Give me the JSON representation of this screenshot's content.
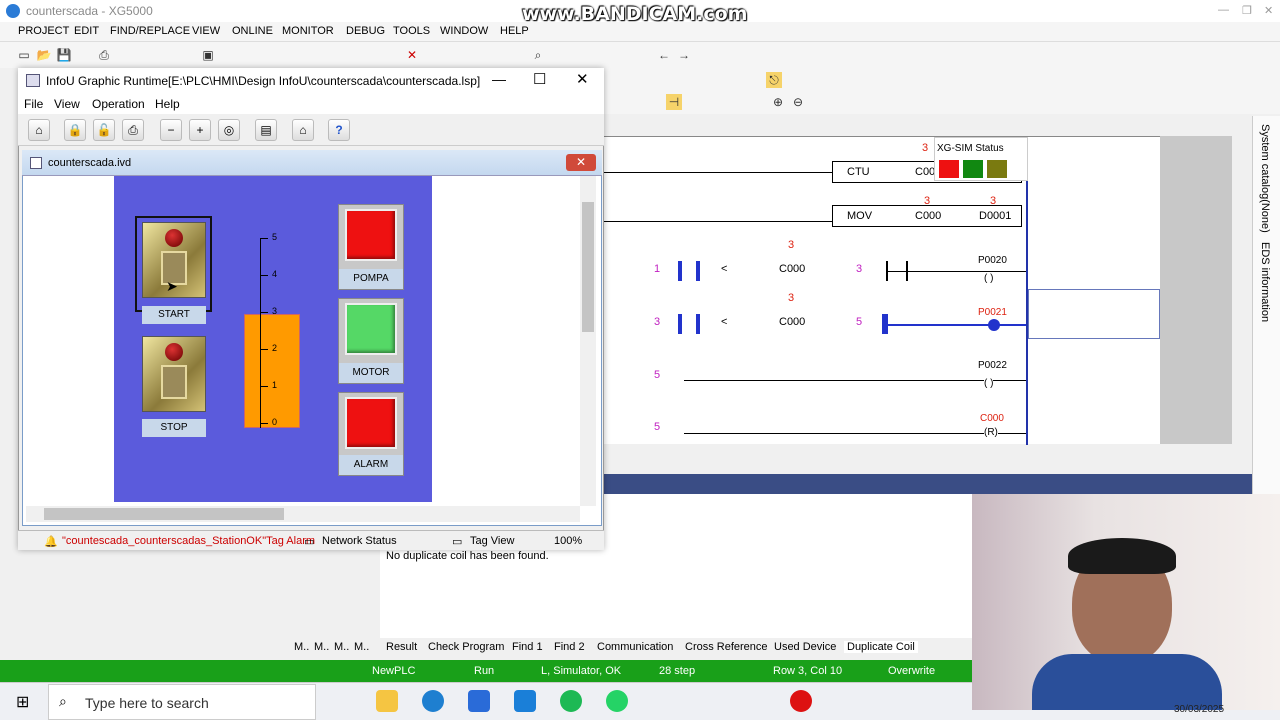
{
  "main": {
    "title": "counterscada - XG5000",
    "watermark": "www.BANDICAM.com",
    "menu": [
      "PROJECT",
      "EDIT",
      "FIND/REPLACE",
      "VIEW",
      "ONLINE",
      "MONITOR",
      "DEBUG",
      "TOOLS",
      "WINDOW",
      "HELP"
    ]
  },
  "ladder": {
    "sim_status_label": "XG-SIM Status",
    "sim_colors": [
      "#ee1111",
      "#118811",
      "#7a7a10"
    ],
    "rung1": {
      "count_val": "3",
      "instr": "CTU",
      "operand": "C00"
    },
    "rung2": {
      "val1": "3",
      "val2": "3",
      "instr": "MOV",
      "src": "C000",
      "dst": "D0001"
    },
    "rung3": {
      "lhs": "1",
      "op": "<",
      "counter": "C000",
      "rhs": "3",
      "cur": "3",
      "coil": "P0020"
    },
    "rung4": {
      "lhs": "3",
      "op": "<",
      "counter": "C000",
      "rhs": "5",
      "cur": "3",
      "coil": "P0021"
    },
    "rung5": {
      "val": "5",
      "coil": "P0022"
    },
    "rung6": {
      "val": "5",
      "coil": "C000",
      "coil_type": "(R)"
    }
  },
  "right_panel": {
    "tab1": "System catalog(None)",
    "tab2": "EDS information"
  },
  "lower_panel": {
    "message": "No duplicate coil has been found."
  },
  "bottom_tabs": [
    "M..",
    "M..",
    "M..",
    "M..",
    "Result",
    "Check Program",
    "Find 1",
    "Find 2",
    "Communication",
    "Cross Reference",
    "Used Device",
    "Duplicate Coil"
  ],
  "statusbar": {
    "plc": "NewPLC",
    "mode": "Run",
    "conn": "L, Simulator, OK",
    "steps": "28 step",
    "pos": "Row 3, Col 10",
    "ins": "Overwrite"
  },
  "taskbar": {
    "search_placeholder": "Type here to search",
    "date": "30/03/2025"
  },
  "infou": {
    "title": "InfoU Graphic Runtime[E:\\PLC\\HMI\\Design InfoU\\counterscada\\counterscada.lsp]",
    "menu": [
      "File",
      "View",
      "Operation",
      "Help"
    ],
    "child_title": "counterscada.ivd",
    "scada": {
      "start_label": "START",
      "stop_label": "STOP",
      "gauge_ticks": [
        "5",
        "4",
        "3",
        "2",
        "1",
        "0"
      ],
      "gauge_value": 3,
      "gauge_max": 5,
      "pompa_label": "POMPA",
      "motor_label": "MOTOR",
      "alarm_label": "ALARM",
      "pompa_color": "#ee1111",
      "motor_color": "#55d866",
      "alarm_color": "#ee1111",
      "gauge_color": "#ff9a00"
    },
    "status": {
      "alarm": "\"countescada_counterscadas_StationOK\"Tag Alarm",
      "network": "Network Status",
      "tagview": "Tag View",
      "zoom": "100%"
    }
  }
}
